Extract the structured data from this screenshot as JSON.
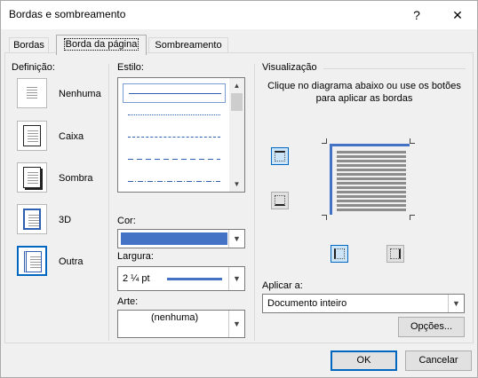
{
  "window": {
    "title": "Bordas e sombreamento",
    "help": "?",
    "close": "✕"
  },
  "tabs": [
    {
      "label": "Bordas"
    },
    {
      "label": "Borda da página"
    },
    {
      "label": "Sombreamento"
    }
  ],
  "definicao": {
    "label": "Definição:",
    "options": [
      {
        "label": "Nenhuma",
        "icon": "no-border-icon"
      },
      {
        "label": "Caixa",
        "icon": "box-border-icon"
      },
      {
        "label": "Sombra",
        "icon": "shadow-border-icon"
      },
      {
        "label": "3D",
        "icon": "3d-border-icon"
      },
      {
        "label": "Outra",
        "icon": "custom-border-icon",
        "selected": true
      }
    ]
  },
  "estilo": {
    "label": "Estilo:",
    "items": [
      "solid",
      "dotted",
      "dashed-small",
      "dashed-large",
      "dash-dot"
    ],
    "selected_index": 0
  },
  "cor": {
    "label": "Cor:",
    "value_color": "#4472c4"
  },
  "largura": {
    "label": "Largura:",
    "value": "2 ¼ pt"
  },
  "arte": {
    "label": "Arte:",
    "value": "(nenhuma)"
  },
  "visualizacao": {
    "label": "Visualização",
    "instructions": "Clique no diagrama abaixo ou use os botões para aplicar as bordas"
  },
  "aplicar": {
    "label": "Aplicar a:",
    "value": "Documento inteiro"
  },
  "buttons": {
    "options": "Opções...",
    "ok": "OK",
    "cancel": "Cancelar"
  },
  "colors": {
    "accent": "#0067c0",
    "border_blue": "#4472c4"
  }
}
